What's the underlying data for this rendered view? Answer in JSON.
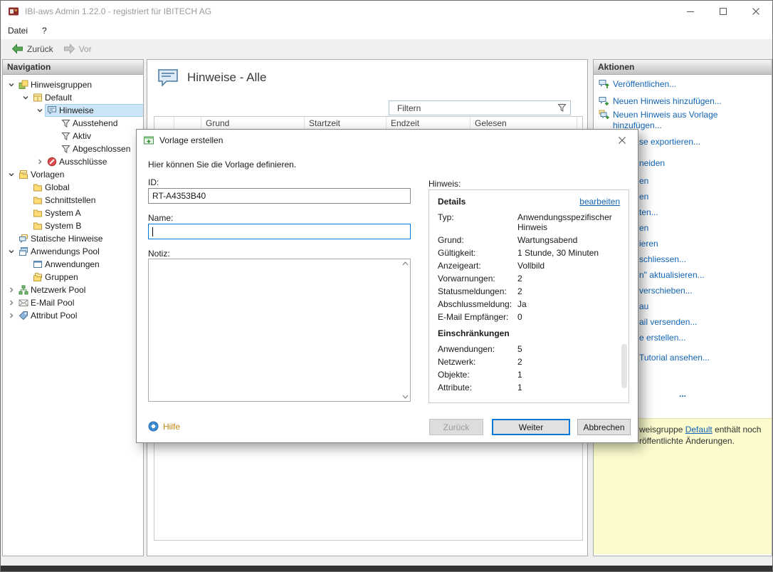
{
  "window": {
    "title": "IBI-aws Admin 1.22.0 - registriert für IBITECH AG"
  },
  "menubar": {
    "items": [
      {
        "label": "Datei"
      },
      {
        "label": "?"
      }
    ]
  },
  "toolbar": {
    "back_label": "Zurück",
    "forward_label": "Vor"
  },
  "colors": {
    "link": "#1265B5",
    "accent": "#0078D7",
    "selection": "#CDE6F7",
    "notification_bg": "#FBFBCD",
    "help_link": "#C1830F"
  },
  "navigation": {
    "header": "Navigation",
    "tree": [
      {
        "label": "Hinweisgruppen",
        "level": 0,
        "expander": "expanded",
        "icon": "hinweisgruppen-icon",
        "selected": false
      },
      {
        "label": "Default",
        "level": 1,
        "expander": "expanded",
        "icon": "hinweisgruppe-icon",
        "selected": false
      },
      {
        "label": "Hinweise",
        "level": 2,
        "expander": "expanded",
        "icon": "hinweise-icon",
        "selected": true
      },
      {
        "label": "Ausstehend",
        "level": 3,
        "expander": "none",
        "icon": "filter-pending-icon",
        "selected": false
      },
      {
        "label": "Aktiv",
        "level": 3,
        "expander": "none",
        "icon": "filter-active-icon",
        "selected": false
      },
      {
        "label": "Abgeschlossen",
        "level": 3,
        "expander": "none",
        "icon": "filter-done-icon",
        "selected": false
      },
      {
        "label": "Ausschlüsse",
        "level": 2,
        "expander": "collapsed",
        "icon": "ausschluesse-icon",
        "selected": false
      },
      {
        "label": "Vorlagen",
        "level": 0,
        "expander": "expanded",
        "icon": "vorlagen-icon",
        "selected": false
      },
      {
        "label": "Global",
        "level": 1,
        "expander": "none",
        "icon": "folder-icon",
        "selected": false
      },
      {
        "label": "Schnittstellen",
        "level": 1,
        "expander": "none",
        "icon": "folder-icon",
        "selected": false
      },
      {
        "label": "System A",
        "level": 1,
        "expander": "none",
        "icon": "folder-icon",
        "selected": false
      },
      {
        "label": "System B",
        "level": 1,
        "expander": "none",
        "icon": "folder-icon",
        "selected": false
      },
      {
        "label": "Statische Hinweise",
        "level": 0,
        "expander": "none",
        "icon": "statische-hinweise-icon",
        "selected": false
      },
      {
        "label": "Anwendungs Pool",
        "level": 0,
        "expander": "expanded",
        "icon": "anwendungs-pool-icon",
        "selected": false
      },
      {
        "label": "Anwendungen",
        "level": 1,
        "expander": "none",
        "icon": "anwendungen-icon",
        "selected": false
      },
      {
        "label": "Gruppen",
        "level": 1,
        "expander": "none",
        "icon": "gruppen-icon",
        "selected": false
      },
      {
        "label": "Netzwerk Pool",
        "level": 0,
        "expander": "collapsed",
        "icon": "netzwerk-pool-icon",
        "selected": false
      },
      {
        "label": "E-Mail Pool",
        "level": 0,
        "expander": "collapsed",
        "icon": "email-pool-icon",
        "selected": false
      },
      {
        "label": "Attribut Pool",
        "level": 0,
        "expander": "collapsed",
        "icon": "attribut-pool-icon",
        "selected": false
      }
    ]
  },
  "main": {
    "title": "Hinweise - Alle",
    "title_icon": "title-hinweise-icon",
    "filter": {
      "placeholder": "Filtern",
      "icon": "funnel-icon"
    },
    "table": {
      "columns": [
        "",
        "",
        "Grund",
        "Startzeit",
        "Endzeit",
        "Gelesen"
      ]
    }
  },
  "actions": {
    "header": "Aktionen",
    "items": [
      {
        "label": "Veröffentlichen...",
        "icon": "publish-icon",
        "partial": false
      },
      {
        "label": "Neuen Hinweis hinzufügen...",
        "icon": "add-hinweis-icon",
        "partial": false
      },
      {
        "label": "Neuen Hinweis aus Vorlage hinzufügen...",
        "icon": "add-from-template-icon",
        "partial": false
      },
      {
        "label": "se exportieren...",
        "partial": true
      },
      {
        "label": "neiden",
        "partial": true
      },
      {
        "label": "en",
        "partial": true
      },
      {
        "label": "en",
        "partial": true
      },
      {
        "label": "ten...",
        "partial": true
      },
      {
        "label": "en",
        "partial": true
      },
      {
        "label": "ieren",
        "partial": true
      },
      {
        "label": "schliessen...",
        "partial": true
      },
      {
        "label": "n\" aktualisieren...",
        "partial": true
      },
      {
        "label": "verschieben...",
        "partial": true
      },
      {
        "label": "au",
        "partial": true
      },
      {
        "label": "ail versenden...",
        "partial": true
      },
      {
        "label": "e erstellen...",
        "partial": true
      },
      {
        "label": "Tutorial ansehen...",
        "partial": true
      }
    ],
    "overflow": "..."
  },
  "notification": {
    "line1_pre": "weisgruppe ",
    "line1_link": "Default",
    "line1_post": " enthält noch",
    "line2": "röffentlichte Änderungen."
  },
  "dialog": {
    "title": "Vorlage erstellen",
    "description": "Hier können Sie die Vorlage definieren.",
    "fields": {
      "id": {
        "label": "ID:",
        "value": "RT-A4353B40"
      },
      "name": {
        "label": "Name:",
        "value": ""
      },
      "notiz": {
        "label": "Notiz:",
        "value": ""
      }
    },
    "hinweis": {
      "label": "Hinweis:",
      "details_header": "Details",
      "edit_link": "bearbeiten",
      "details": [
        {
          "label": "Typ:",
          "value": "Anwendungsspezifischer Hinweis"
        },
        {
          "label": "Grund:",
          "value": "Wartungsabend"
        },
        {
          "label": "Gültigkeit:",
          "value": "1 Stunde, 30 Minuten"
        },
        {
          "label": "Anzeigeart:",
          "value": "Vollbild"
        },
        {
          "label": "Vorwarnungen:",
          "value": "2"
        },
        {
          "label": "Statusmeldungen:",
          "value": "2"
        },
        {
          "label": "Abschlussmeldung:",
          "value": "Ja"
        },
        {
          "label": "E-Mail Empfänger:",
          "value": "0"
        }
      ],
      "restrictions_header": "Einschränkungen",
      "restrictions": [
        {
          "label": "Anwendungen:",
          "value": "5"
        },
        {
          "label": "Netzwerk:",
          "value": "2"
        },
        {
          "label": "Objekte:",
          "value": "1"
        },
        {
          "label": "Attribute:",
          "value": "1"
        }
      ]
    },
    "help_label": "Hilfe",
    "buttons": {
      "back": {
        "label": "Zurück",
        "enabled": false
      },
      "next": {
        "label": "Weiter",
        "default": true
      },
      "cancel": {
        "label": "Abbrechen",
        "enabled": true
      }
    }
  }
}
